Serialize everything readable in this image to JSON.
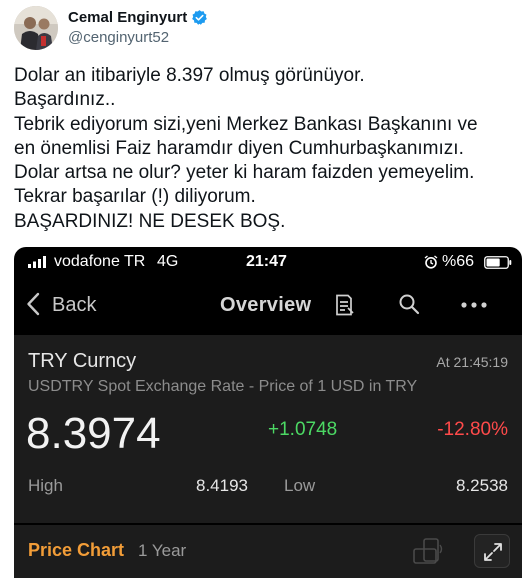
{
  "tweet": {
    "author": {
      "name": "Cemal Enginyurt",
      "handle": "@cenginyurt52",
      "verified": true,
      "verified_color": "#1d9bf0"
    },
    "lines": [
      "Dolar an itibariyle 8.397 olmuş görünüyor.",
      "Başardınız..",
      "Tebrik ediyorum sizi,yeni Merkez Bankası Başkanını ve",
      "en önemlisi Faiz haramdır diyen Cumhurbaşkanımızı.",
      "Dolar artsa ne olur? yeter ki haram faizden yemeyelim.",
      "Tekrar başarılar (!) diliyorum.",
      "BAŞARDINIZ! NE DESEK BOŞ."
    ]
  },
  "screenshot": {
    "status_bar": {
      "signal_icon": "signal-bars-icon",
      "carrier": "vodafone TR",
      "network": "4G",
      "time": "21:47",
      "alarm_icon": "alarm-icon",
      "battery": "%66",
      "battery_level": 0.66
    },
    "nav": {
      "back_label": "Back",
      "title": "Overview",
      "icons": [
        "back-chevron-icon",
        "notes-icon",
        "search-icon",
        "more-icon"
      ]
    },
    "quote": {
      "name": "TRY Curncy",
      "time": "At 21:45:19",
      "description": "USDTRY Spot Exchange Rate - Price of 1 USD in TRY",
      "price": "8.3974",
      "change": "+1.0748",
      "change_pct": "-12.80%",
      "high_label": "High",
      "high_value": "8.4193",
      "low_label": "Low",
      "low_value": "8.2538"
    },
    "chart_section": {
      "title": "Price Chart",
      "range": "1 Year",
      "icons": [
        "rotate-device-icon",
        "expand-icon"
      ]
    },
    "colors": {
      "positive": "#4cd964",
      "negative": "#ff4a4a",
      "accent": "#f29d38",
      "background": "#000000",
      "card": "#1c1c1c"
    }
  }
}
